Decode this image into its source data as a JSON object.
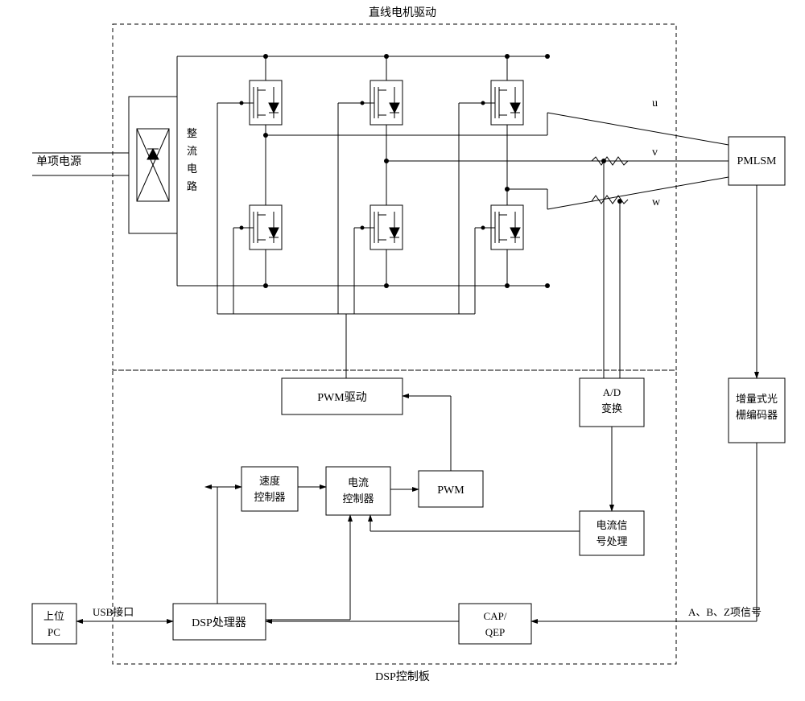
{
  "title_top": "直线电机驱动",
  "title_bottom": "DSP控制板",
  "power_label": "单项电源",
  "rectifier_label": "整\n流\n电\n路",
  "phase_u": "u",
  "phase_v": "v",
  "phase_w": "w",
  "motor": "PMLSM",
  "encoder": "增量式光\n栅编码器",
  "pwm_drive": "PWM驱动",
  "ad": "A/D\n变换",
  "speed_ctrl": "速度\n控制器",
  "current_ctrl": "电流\n控制器",
  "pwm": "PWM",
  "current_proc": "电流信\n号处理",
  "dsp": "DSP处理器",
  "cap_qep": "CAP/\nQEP",
  "pc": "上位\nPC",
  "usb": "USB接口",
  "abz": "A、B、Z项信号"
}
